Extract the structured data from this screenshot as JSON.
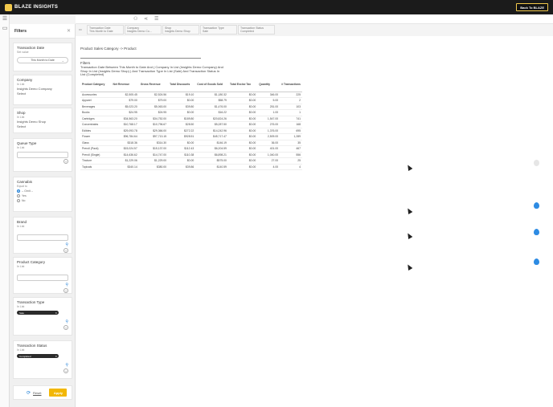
{
  "app": {
    "brand": "BLAZE INSIGHTS",
    "back_label": "Back To BLAZE"
  },
  "filters_panel": {
    "title": "Filters",
    "transaction_date": {
      "title": "Transaction Date",
      "sub": "Set value",
      "value": "This Month to Date"
    },
    "company": {
      "title": "Company",
      "sub": "In List",
      "value": "Insights Demo Company",
      "action": "Select"
    },
    "shop": {
      "title": "Shop",
      "sub": "In List",
      "value": "Insights Demo Shop",
      "action": "Select"
    },
    "queue_type": {
      "title": "Queue Type",
      "sub": "In List"
    },
    "cannabis": {
      "title": "Cannabis",
      "sub": "Equal to",
      "options": [
        "-- Omit --",
        "Yes",
        "No"
      ]
    },
    "brand": {
      "title": "Brand",
      "sub": "In List"
    },
    "product_category": {
      "title": "Product Category",
      "sub": "In List"
    },
    "transaction_type": {
      "title": "Transaction Type",
      "sub": "In List",
      "chip": "Sale"
    },
    "transaction_status": {
      "title": "Transaction Status",
      "sub": "In List",
      "chip": "Completed"
    },
    "reset_label": "Reset",
    "apply_label": "Apply"
  },
  "filter_chips": [
    {
      "l1": "Transaction Date",
      "l2": "This Month to Date"
    },
    {
      "l1": "Company",
      "l2": "Insights Demo Co..."
    },
    {
      "l1": "Shop",
      "l2": "Insights Demo Shop"
    },
    {
      "l1": "Transaction Type",
      "l2": "Sale"
    },
    {
      "l1": "Transaction Status",
      "l2": "Completed"
    }
  ],
  "report": {
    "title": "Product Sales Category -> Product",
    "filters_label": "Filters",
    "filters_desc": "Transaction Date Between This Month to Date And ( Company In List (Insights Demo Company) And Shop In List (Insights Demo Shop) ) And Transaction Type In List (Sale) And Transaction Status In List (Completed)",
    "columns": [
      "Product Category",
      "Net Revenue",
      "Gross Revenue",
      "Total Discounts",
      "Cost of Goods Sold",
      "Total Excise Tax",
      "Quantity",
      "# Transactions"
    ],
    "rows": [
      [
        "Accessories",
        "$2,505.45",
        "$2,524.56",
        "$19.10",
        "$1,180.32",
        "$0.00",
        "346.00",
        "225"
      ],
      [
        "Apparel",
        "$79.00",
        "$79.00",
        "$0.00",
        "$58.79",
        "$0.00",
        "5.00",
        "2"
      ],
      [
        "Beverages",
        "$5,023.20",
        "$5,063.00",
        "$39.80",
        "$1,476.00",
        "$0.00",
        "251.00",
        "103"
      ],
      [
        "Books",
        "$24.95",
        "$24.95",
        "$0.00",
        "$16.22",
        "$0.00",
        "1.00",
        "1"
      ],
      [
        "Cartridges",
        "$34,563.20",
        "$34,752.00",
        "$189.80",
        "$20,824.26",
        "$0.00",
        "1,547.00",
        "741"
      ],
      [
        "Concentrates",
        "$10,768.17",
        "$10,796.67",
        "$28.50",
        "$5,287.50",
        "$0.00",
        "276.00",
        "168"
      ],
      [
        "Edibles",
        "$29,093.78",
        "$29,366.00",
        "$272.22",
        "$14,242.96",
        "$0.00",
        "1,376.00",
        "695"
      ],
      [
        "Flower",
        "$96,784.64",
        "$97,713.15",
        "$928.51",
        "$45,717.47",
        "$0.00",
        "2,509.00",
        "1,289"
      ],
      [
        "Glass",
        "$318.36",
        "$314.30",
        "$0.00",
        "$146.19",
        "$0.00",
        "36.00",
        "35"
      ],
      [
        "Preroll (Pack)",
        "$15,024.57",
        "$15,137.00",
        "$112.43",
        "$6,204.59",
        "$0.00",
        "401.00",
        "467"
      ],
      [
        "Preroll (Single)",
        "$14,636.62",
        "$14,747.00",
        "$110.38",
        "$6,898.21",
        "$0.00",
        "1,040.00",
        "556"
      ],
      [
        "Tincture",
        "$1,229.06",
        "$1,229.00",
        "$0.00",
        "$575.00",
        "$0.00",
        "27.00",
        "25"
      ],
      [
        "Topicals",
        "$340.14",
        "$380.00",
        "$39.86",
        "$140.59",
        "$0.00",
        "4.00",
        "4"
      ]
    ]
  }
}
